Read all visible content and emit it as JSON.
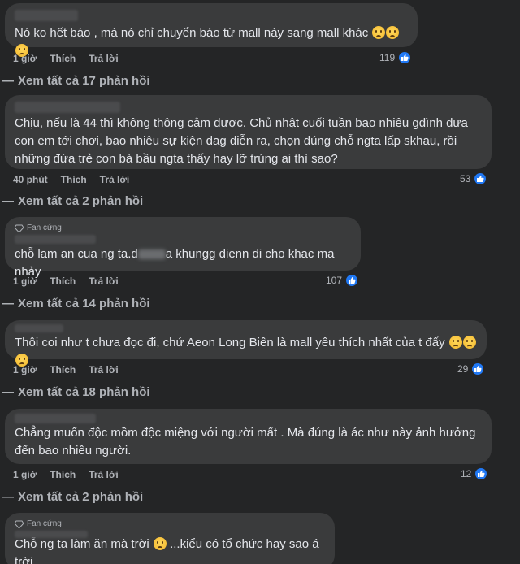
{
  "comments": [
    {
      "badge": "",
      "text": "Nó ko hết báo , mà nó chỉ chuyển báo từ mall này sang mall khác",
      "emojis": 3,
      "time": "1 giờ",
      "like": "Thích",
      "reply": "Trả lời",
      "reactions": "119",
      "more_replies": "Xem tất cả 17 phản hồi"
    },
    {
      "badge": "",
      "text": "Chịu, nếu là 44 thì không thông cảm được. Chủ nhật cuối tuần bao nhiêu gđình đưa con em tới chơi, bao nhiêu sự kiện đag diễn ra, chọn đúng chỗ ngta lấp skhau, rồi những đứa trẻ con bà bầu ngta thấy hay lỡ trúng ai thì sao?",
      "time": "40 phút",
      "like": "Thích",
      "reply": "Trả lời",
      "reactions": "53",
      "more_replies": "Xem tất cả 2 phản hồi"
    },
    {
      "badge": "Fan cứng",
      "text_before": "chỗ lam an cua ng ta.d",
      "text_after": "a khungg dienn di cho khac ma nhảy",
      "time": "1 giờ",
      "like": "Thích",
      "reply": "Trả lời",
      "reactions": "107",
      "more_replies": "Xem tất cả 14 phản hồi"
    },
    {
      "badge": "",
      "text": "Thôi coi như t chưa đọc đi, chứ Aeon Long Biên là mall yêu thích nhất của t đấy",
      "emojis": 3,
      "time": "1 giờ",
      "like": "Thích",
      "reply": "Trả lời",
      "reactions": "29",
      "more_replies": "Xem tất cả 18 phản hồi"
    },
    {
      "badge": "",
      "text": "Chẳng muốn độc mồm độc miệng với người mất . Mà đúng là ác như này ảnh hưởng đến bao nhiêu người.",
      "time": "1 giờ",
      "like": "Thích",
      "reply": "Trả lời",
      "reactions": "12",
      "more_replies": "Xem tất cả 2 phản hồi"
    },
    {
      "badge": "Fan cứng",
      "text_before": "Chỗ ng ta làm ăn mà trời",
      "text_after": "...kiểu có tổ chức hay sao á trời"
    }
  ],
  "icons": {
    "like": "thumbs-up-icon",
    "badge": "diamond-icon",
    "reply_arrow": "reply-arrow-icon"
  },
  "colors": {
    "background": "#242526",
    "bubble": "#3a3b3c",
    "like_blue": "#2078f4",
    "secondary_text": "#b0b3b8"
  }
}
